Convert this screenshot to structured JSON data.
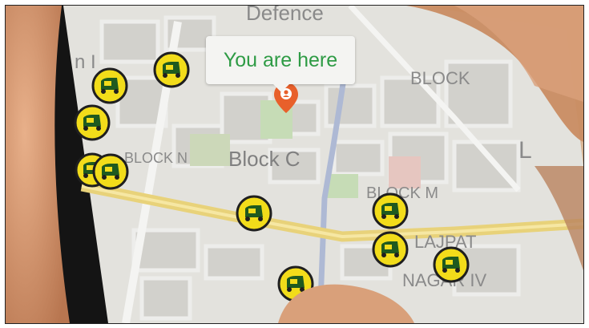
{
  "map": {
    "bubble_text": "You are here",
    "labels": {
      "defence": "Defence",
      "block_c": "Block C",
      "block_n": "BLOCK N",
      "block_top": "BLOCK",
      "block_m": "BLOCK M",
      "lajpat": "LAJPAT",
      "nagar": "NAGAR IV",
      "n_left": "n I",
      "l_right": "L"
    }
  },
  "colors": {
    "auto_yellow": "#f2dc1a",
    "auto_green": "#1f5a1f",
    "pin_orange": "#e8602b",
    "road_yellow": "#e8d27a",
    "bubble_text": "#2e9b45"
  }
}
